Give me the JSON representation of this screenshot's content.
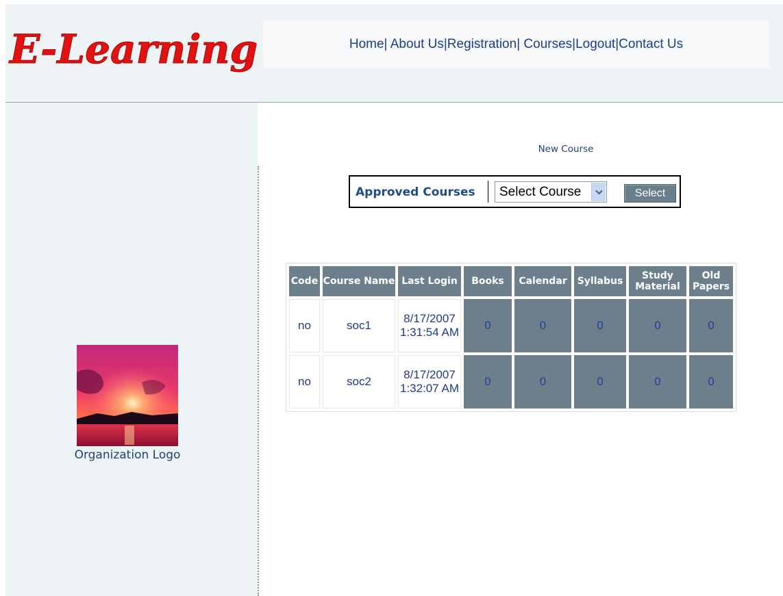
{
  "brand": {
    "title": "E-Learning",
    "color": "#e01212"
  },
  "nav": {
    "links": [
      "Home",
      "About Us",
      "Registration",
      "Courses",
      "Logout",
      "Contact Us"
    ],
    "separator": "|"
  },
  "sidebar": {
    "logo_label": "Organization Logo"
  },
  "main": {
    "new_course_link": "New Course",
    "approved_courses": {
      "label": "Approved Courses",
      "select_value": "Select Course",
      "button_label": "Select"
    },
    "table": {
      "headers": [
        "Code",
        "Course Name",
        "Last Login",
        "Books",
        "Calendar",
        "Syllabus",
        "Study Material",
        "Old Papers"
      ],
      "rows": [
        {
          "code": "no",
          "course_name": "soc1",
          "last_login": "8/17/2007 1:31:54 AM",
          "books": "0",
          "calendar": "0",
          "syllabus": "0",
          "study_material": "0",
          "old_papers": "0"
        },
        {
          "code": "no",
          "course_name": "soc2",
          "last_login": "8/17/2007 1:32:07 AM",
          "books": "0",
          "calendar": "0",
          "syllabus": "0",
          "study_material": "0",
          "old_papers": "0"
        }
      ]
    }
  },
  "colors": {
    "header_bg": "#eef3f6",
    "table_header_bg": "#6d7f8b",
    "link_blue": "#1a3e8c"
  }
}
